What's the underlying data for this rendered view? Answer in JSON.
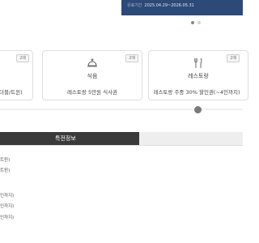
{
  "header": {
    "validity_label": "유효기간",
    "validity_value": "2025.04.29~2026.05.31",
    "banner_color": "#2c4a78"
  },
  "carousel": {
    "dots": 2,
    "active_dot": 0
  },
  "cards": [
    {
      "badge": "2매",
      "description": "더블/트윈)"
    },
    {
      "badge": "2매",
      "icon": "food-cloche-icon",
      "title": "식음",
      "description": "레스토랑 5만원 식사권"
    },
    {
      "badge": "2매",
      "icon": "cutlery-icon",
      "title": "레스토랑",
      "description": "레스토랑 주중 30% 할인권(~4인까지)"
    }
  ],
  "tabs": {
    "active_label": "특전정보"
  },
  "details": [
    "트윈)",
    "트윈)",
    "인까지)",
    "인까지)",
    "인까지)"
  ]
}
